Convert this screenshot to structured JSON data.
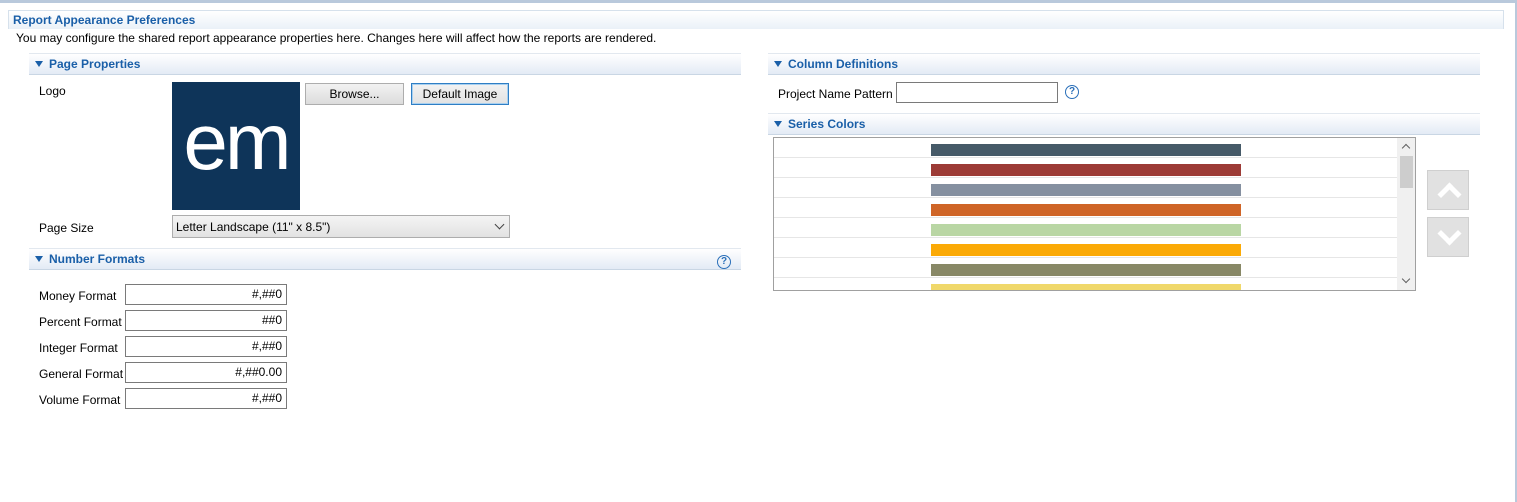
{
  "page": {
    "title": "Report Appearance Preferences",
    "description": "You may configure the shared report appearance properties here.  Changes here will affect how the reports are rendered."
  },
  "page_properties": {
    "section_title": "Page Properties",
    "logo_label": "Logo",
    "logo_text": "em",
    "browse_label": "Browse...",
    "default_image_label": "Default Image",
    "page_size_label": "Page Size",
    "page_size_value": "Letter Landscape (11\" x 8.5\")"
  },
  "number_formats": {
    "section_title": "Number Formats",
    "help_glyph": "?",
    "fields": [
      {
        "label": "Money Format",
        "value": "#,##0"
      },
      {
        "label": "Percent Format",
        "value": "##0"
      },
      {
        "label": "Integer Format",
        "value": "#,##0"
      },
      {
        "label": "General Format",
        "value": "#,##0.00"
      },
      {
        "label": "Volume Format",
        "value": "#,##0"
      }
    ]
  },
  "column_definitions": {
    "section_title": "Column Definitions",
    "project_name_pattern_label": "Project Name Pattern",
    "project_name_pattern_value": "",
    "help_glyph": "?"
  },
  "series_colors": {
    "section_title": "Series Colors",
    "colors": [
      "#465a68",
      "#9c3b36",
      "#8590a0",
      "#cf6527",
      "#b9d6a4",
      "#fbaa06",
      "#888866",
      "#f0d86a"
    ],
    "move_up_icon": "chevron-up-icon",
    "move_down_icon": "chevron-down-icon"
  },
  "theme": {
    "title_color": "#1a5fa8",
    "logo_bg": "#0e3459"
  }
}
